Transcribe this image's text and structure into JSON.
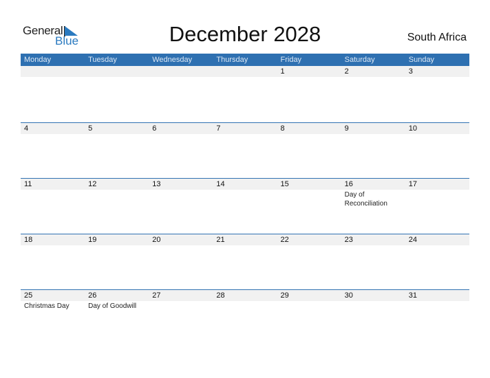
{
  "logo": {
    "line1": "General",
    "line2": "Blue"
  },
  "title": "December 2028",
  "country": "South Africa",
  "colors": {
    "header_bg": "#2e70b1",
    "date_strip": "#f1f1f1",
    "brand_blue": "#2a7ac0"
  },
  "weekdays": [
    "Monday",
    "Tuesday",
    "Wednesday",
    "Thursday",
    "Friday",
    "Saturday",
    "Sunday"
  ],
  "weeks": [
    {
      "days": [
        "",
        "",
        "",
        "",
        "1",
        "2",
        "3"
      ],
      "events": [
        "",
        "",
        "",
        "",
        "",
        "",
        ""
      ]
    },
    {
      "days": [
        "4",
        "5",
        "6",
        "7",
        "8",
        "9",
        "10"
      ],
      "events": [
        "",
        "",
        "",
        "",
        "",
        "",
        ""
      ]
    },
    {
      "days": [
        "11",
        "12",
        "13",
        "14",
        "15",
        "16",
        "17"
      ],
      "events": [
        "",
        "",
        "",
        "",
        "",
        "Day of Reconciliation",
        ""
      ]
    },
    {
      "days": [
        "18",
        "19",
        "20",
        "21",
        "22",
        "23",
        "24"
      ],
      "events": [
        "",
        "",
        "",
        "",
        "",
        "",
        ""
      ]
    },
    {
      "days": [
        "25",
        "26",
        "27",
        "28",
        "29",
        "30",
        "31"
      ],
      "events": [
        "Christmas Day",
        "Day of Goodwill",
        "",
        "",
        "",
        "",
        ""
      ]
    }
  ]
}
